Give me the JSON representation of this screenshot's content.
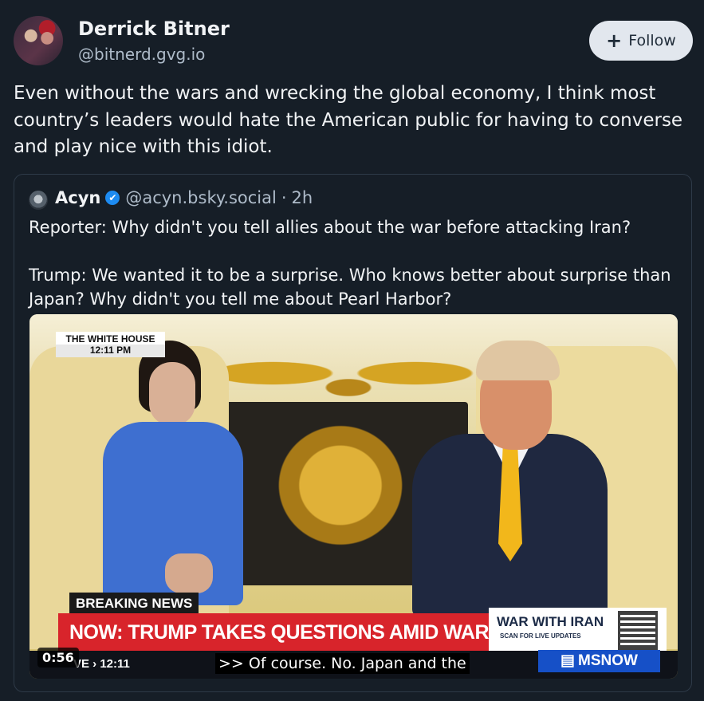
{
  "author": {
    "name": "Derrick Bitner",
    "handle": "@bitnerd.gvg.io"
  },
  "follow": {
    "icon": "+",
    "label": "Follow"
  },
  "post": {
    "text": "Even without the wars and wrecking the global economy, I think most country’s leaders would hate the American public for having to converse and play nice with this idiot."
  },
  "quote": {
    "name": "Acyn",
    "verified_icon": "✔",
    "handle": "@acyn.bsky.social",
    "separator": "·",
    "time": "2h",
    "text": "Reporter: Why didn't you tell allies about the war before attacking Iran?\n\nTrump: We wanted it to be a surprise. Who knows better about surprise than Japan? Why didn't you tell me about Pearl Harbor?"
  },
  "video": {
    "location_badge": "THE WHITE HOUSE",
    "location_time": "12:11 PM",
    "breaking": "BREAKING NEWS",
    "headline": "NOW: TRUMP TAKES QUESTIONS AMID WAR WITH IRAN",
    "side_title": "WAR WITH IRAN",
    "side_sub": "SCAN FOR LIVE UPDATES",
    "ticker": "VE › 12:11",
    "network": "MSNOW",
    "duration": "0:56",
    "caption": ">> Of course. No. Japan and the"
  }
}
